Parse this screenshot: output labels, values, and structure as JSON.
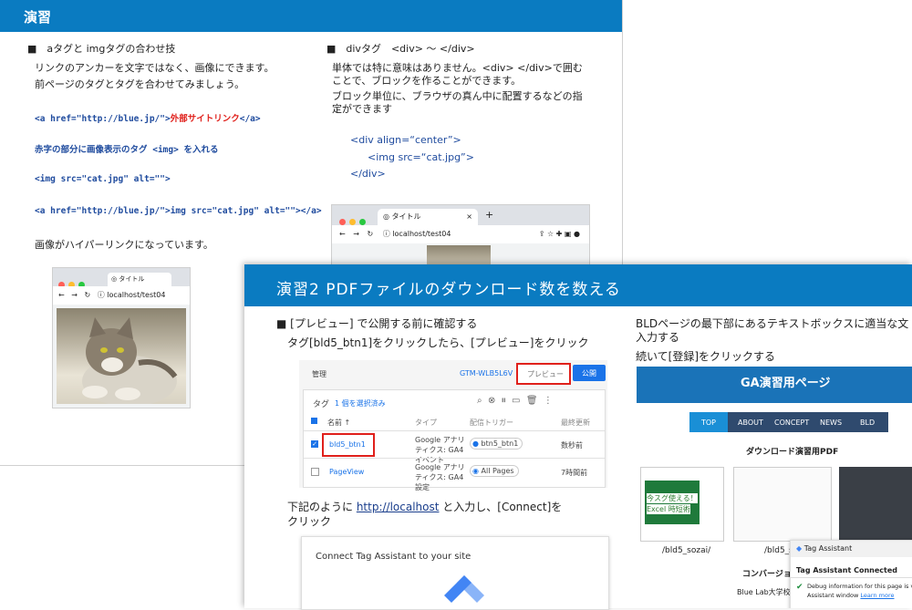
{
  "slide1": {
    "title": "演習",
    "left": {
      "heading": "■　aタグと imgタグの合わせ技",
      "line1": "リンクのアンカーを文字ではなく、画像にできます。",
      "line2": "前ページのタグとタグを合わせてみましょう。",
      "code1_prefix": "<a href=\"http://blue.jp/\">",
      "code1_red": "外部サイトリンク",
      "code1_suffix": "</a>",
      "note": "赤字の部分に画像表示のタグ <img> を入れる",
      "code2": "<img src=\"cat.jpg\" alt=\"\">",
      "code3": "<a href=\"http://blue.jp/\">img src=\"cat.jpg\" alt=\"\"></a>",
      "caption": "画像がハイパーリンクになっています。",
      "browser_tab": "タイトル",
      "browser_url": "localhost/test04"
    },
    "right": {
      "heading": "■　divタグ　<div> ～ </div>",
      "line1": "単体では特に意味はありません。<div> </div>で囲む",
      "line2": "ことで、ブロックを作ることができます。",
      "line3": "ブロック単位に、ブラウザの真ん中に配置するなどの指",
      "line4": "定ができます",
      "code1": "<div align=“center”>",
      "code2": "<img src=“cat.jpg”>",
      "code3": "</div>",
      "browser_tab": "タイトル",
      "browser_url": "localhost/test04"
    }
  },
  "slide2": {
    "title": "演習2 PDFファイルのダウンロード数を数える",
    "left": {
      "heading": "■ [プレビュー] で公開する前に確認する",
      "line1": "タグ[bld5_btn1]をクリックしたら、[プレビュー]をクリック",
      "gtm": {
        "admin": "管理",
        "container_id": "GTM-WLB5L6V",
        "preview": "プレビュー",
        "publish": "公開",
        "tags_label": "タグ",
        "selected": "1 個を選択済み",
        "col_name": "名前 ↑",
        "col_type": "タイプ",
        "col_trigger": "配信トリガー",
        "col_updated": "最終更新",
        "rows": [
          {
            "name": "bld5_btn1",
            "type": "Google アナリティクス: GA4 イベント",
            "trigger": "btn5_btn1",
            "updated": "数秒前",
            "checked": true
          },
          {
            "name": "PageView",
            "type": "Google アナリティクス: GA4 設定",
            "trigger": "All Pages",
            "updated": "7時間前",
            "checked": false
          }
        ]
      },
      "line2_prefix": "下記のように ",
      "line2_link": "http://localhost",
      "line2_suffix": " と入力し、[Connect]を",
      "line3": "クリック",
      "connect_title": "Connect Tag Assistant to your site"
    },
    "right": {
      "line1": "BLDページの最下部にあるテキストボックスに適当な文",
      "line2": "入力する",
      "line3": "続いて[登録]をクリックする",
      "ga_title": "GA演習用ページ",
      "nav": [
        "TOP",
        "ABOUT",
        "CONCEPT",
        "NEWS",
        "BLD"
      ],
      "section_title": "ダウンロード演習用PDF",
      "thumb1_text1": "今スグ使える！",
      "thumb1_text2": "Excel 時短術",
      "pdf1": "/bld5_sozai/",
      "pdf2": "/bld5_so",
      "conversion": "コンバージョン",
      "footer": "Blue Lab大学校 ビ",
      "ta_title": "Tag Assistant",
      "ta_connected": "Tag Assistant Connected",
      "ta_msg1": "Debug information for this page is vie",
      "ta_msg2": "Assistant window",
      "ta_learn": "Learn more"
    }
  },
  "colors": {
    "header_blue": "#0a7bc1",
    "code_blue": "#1f4b9e",
    "code_red": "#e0201b",
    "ga_blue": "#1a73e8"
  }
}
